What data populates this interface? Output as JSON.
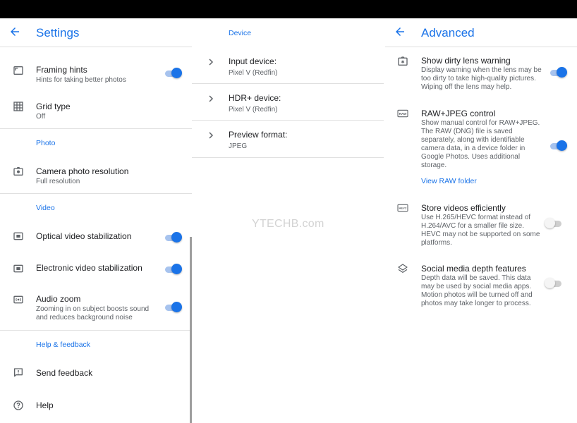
{
  "watermark": "YTECHB.com",
  "settings": {
    "title": "Settings",
    "items": [
      {
        "title": "Framing hints",
        "subtitle": "Hints for taking better photos",
        "on": true
      },
      {
        "title": "Grid type",
        "subtitle": "Off"
      }
    ],
    "photo_section": "Photo",
    "photo_items": [
      {
        "title": "Camera photo resolution",
        "subtitle": "Full resolution"
      }
    ],
    "video_section": "Video",
    "video_items": [
      {
        "title": "Optical video stabilization",
        "on": true
      },
      {
        "title": "Electronic video stabilization",
        "on": true
      },
      {
        "title": "Audio zoom",
        "subtitle_line1": "Zooming in on subject boosts sound",
        "subtitle_line2": "and reduces background noise",
        "on": true
      }
    ],
    "help_section": "Help & feedback",
    "help_items": [
      {
        "title": "Send feedback"
      },
      {
        "title": "Help"
      }
    ]
  },
  "device": {
    "title": "Device",
    "rows": [
      {
        "title": "Input device:",
        "value": "Pixel V (Redfin)"
      },
      {
        "title": "HDR+ device:",
        "value": "Pixel V (Redfin)"
      },
      {
        "title": "Preview format:",
        "value": "JPEG"
      }
    ]
  },
  "advanced": {
    "title": "Advanced",
    "items": [
      {
        "title": "Show dirty lens warning",
        "lines": [
          "Display warning when the lens may be",
          "too dirty to take high-quality pictures.",
          "Wiping off the lens may help."
        ],
        "on": true
      },
      {
        "title": "RAW+JPEG control",
        "lines": [
          "Show manual control for RAW+JPEG.",
          "The RAW (DNG) file is saved",
          "separately, along with identifiable",
          "camera data, in a device folder in",
          "Google Photos. Uses additional",
          "storage."
        ],
        "on": true,
        "link": "View RAW folder"
      },
      {
        "title": "Store videos efficiently",
        "lines": [
          "Use H.265/HEVC format instead of",
          "H.264/AVC for a smaller file size.",
          "HEVC may not be supported on some",
          "platforms."
        ],
        "on": false
      },
      {
        "title": "Social media depth features",
        "lines": [
          "Depth data will be saved. This data",
          "may be used by social media apps.",
          "Motion photos will be turned off and",
          "photos may take longer to process."
        ],
        "on": false
      }
    ],
    "icon_labels": {
      "raw": "RAW",
      "hevc": "HEVC"
    }
  },
  "colors": {
    "accent": "#1a73e8",
    "track_on": "#a7c3ee",
    "text": "#202124",
    "subtext": "#5f6368"
  }
}
